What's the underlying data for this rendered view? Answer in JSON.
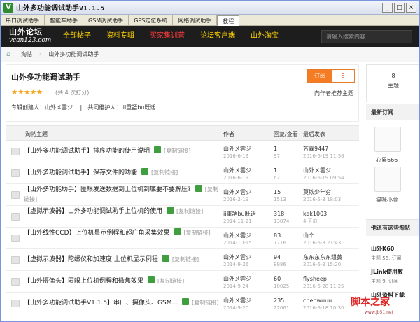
{
  "window": {
    "title": "山外多功能调试助手V1.1.5",
    "min": "_",
    "max": "□",
    "close": "×"
  },
  "tabs": [
    "串口调试助手",
    "智能车助手",
    "GSM调试助手",
    "GPS定位系统",
    "网络调试助手",
    "教程"
  ],
  "nav": {
    "logo_cn": "山外论坛",
    "logo_url": "vcan123.com",
    "items": [
      {
        "label": "全部帖子",
        "color": "#ffd400"
      },
      {
        "label": "资料专辑",
        "color": "#ffd400"
      },
      {
        "label": "买家集训营",
        "color": "#ff3b3b"
      },
      {
        "label": "论坛客户端",
        "color": "#ffd400"
      },
      {
        "label": "山外淘宝",
        "color": "#ffd400"
      }
    ],
    "search_placeholder": "请输入搜索内容"
  },
  "breadcrumb": [
    "淘帖",
    "山外多功能调试助手"
  ],
  "album": {
    "title": "山外多功能调试助手",
    "stars": "★★★★★",
    "votes": "(共 4 次打分)",
    "creator_line": "专辑创建人：山外メ雲ジ　 |　共同维护人： ii重語bu既话",
    "subscribe_label": "订阅",
    "subscribe_count": "8",
    "recommend": "向作者推荐主题"
  },
  "table": {
    "headers": [
      "淘帖主题",
      "作者",
      "回复/查看",
      "最后发表"
    ],
    "copy_label": "[复制链接]",
    "rows": [
      {
        "title": "【山外多功能调试助手】排序功能的使用说明",
        "two": false,
        "author": "山外メ雲ジ",
        "adate": "2016-6-19",
        "replies": "1",
        "views": "97",
        "last": "芳霖9447",
        "ltime": "2016-6-19 11:58"
      },
      {
        "title": "【山外多功能调试助手】保存文件的功能",
        "two": false,
        "author": "山外メ雲ジ",
        "adate": "2016-6-19",
        "replies": "1",
        "views": "62",
        "last": "山外メ雲ジ",
        "ltime": "2016-6-19 09:54"
      },
      {
        "title": "【山外多功能助手】匿眼发送数据到上位机到底要不要解压?",
        "two": true,
        "author": "山外メ雲ジ",
        "adate": "2016-2-19",
        "replies": "15",
        "views": "1513",
        "last": "莫欺少年穷",
        "ltime": "2016-5-3 18:03"
      },
      {
        "title": "【虚拟示波器】山外多功能调试助手上位机的使用",
        "two": true,
        "author": "ii重語bu既话",
        "adate": "2014-11-21",
        "replies": "318",
        "views": "13874",
        "last": "kek1003",
        "ltime": "4 天前"
      },
      {
        "title": "【山外线性CCD】上位机显示例程和超广角采集效果",
        "two": true,
        "author": "山外メ雲ジ",
        "adate": "2014-10-15",
        "replies": "83",
        "views": "7716",
        "last": "山个",
        "ltime": "2016-6-8 21:43"
      },
      {
        "title": "【虚拟示波器】陀螺仪和加速度 上位机显示例程",
        "two": false,
        "author": "山外メ雲ジ",
        "adate": "2014-9-26",
        "replies": "94",
        "views": "8986",
        "last": "东东东东东组黄",
        "ltime": "2016-6-9 15:20"
      },
      {
        "title": "【山外摄像头】匿眼上位机例程和微焦效果",
        "two": false,
        "author": "山外メ雲ジ",
        "adate": "2014-9-24",
        "replies": "60",
        "views": "10025",
        "last": "flysheep",
        "ltime": "2016-6-28 11:25"
      },
      {
        "title": "【山外多功能调试助手V1.1.5】串口、摄像头、GSM...",
        "two": false,
        "author": "山外メ雲ジ",
        "adate": "2014-9-20",
        "replies": "235",
        "views": "27061",
        "last": "chenwuuu",
        "ltime": "2016-6-18 10:30"
      }
    ]
  },
  "sidebar": {
    "topics_count": "8",
    "topics_label": "主题",
    "latest_sub": "最新订阅",
    "subscribers": [
      "心累666",
      "猫咪小萱"
    ],
    "also_sub": "他还有这些淘帖",
    "other": [
      {
        "title": "山外K60",
        "meta": "主题 56, 订阅"
      },
      {
        "title": "JLink使用教",
        "meta": "主题 9, 订阅"
      },
      {
        "title": "山外资料下载",
        "meta": ""
      }
    ]
  },
  "watermark": {
    "text": "脚本之家",
    "url": "www.jb51.net"
  }
}
